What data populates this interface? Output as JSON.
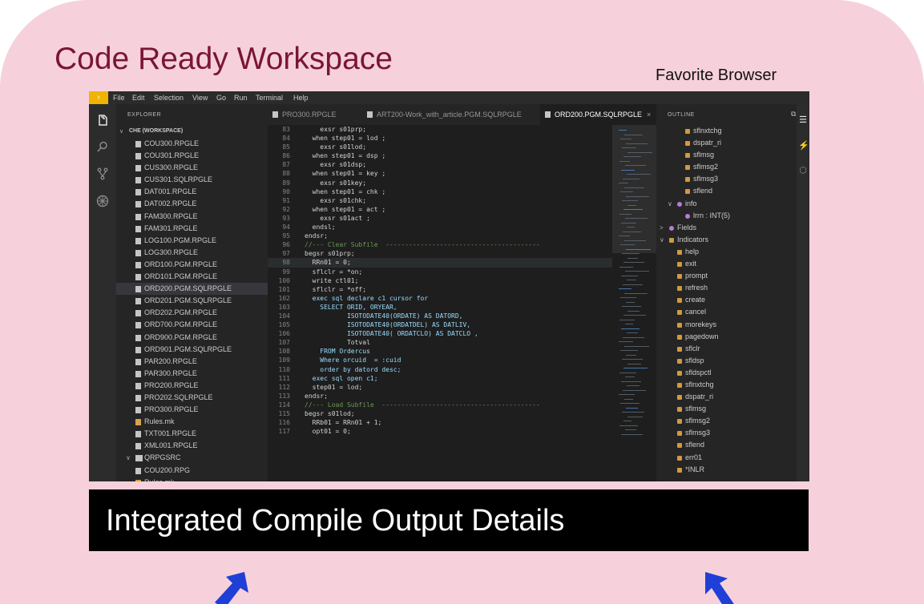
{
  "slide": {
    "title": "Code Ready Workspace",
    "favorite_label": "Favorite Browser",
    "banner_text": "Integrated Compile Output Details",
    "colors": {
      "background": "#f6d1dc",
      "title": "#7a1535",
      "banner": "#000000",
      "arrow": "#1f3fd6"
    }
  },
  "menubar": {
    "items": [
      "File",
      "Edit",
      "Selection",
      "View",
      "Go",
      "Run",
      "Terminal",
      "Help"
    ]
  },
  "activity_icons": [
    "files-icon",
    "search-icon",
    "source-control-icon",
    "extensions-icon"
  ],
  "explorer": {
    "header": "EXPLORER",
    "workspace": "CHE (WORKSPACE)",
    "items": [
      {
        "name": "COU300.RPGLE",
        "type": "file"
      },
      {
        "name": "COU301.RPGLE",
        "type": "file"
      },
      {
        "name": "CUS300.RPGLE",
        "type": "file"
      },
      {
        "name": "CUS301.SQLRPGLE",
        "type": "file"
      },
      {
        "name": "DAT001.RPGLE",
        "type": "file"
      },
      {
        "name": "DAT002.RPGLE",
        "type": "file"
      },
      {
        "name": "FAM300.RPGLE",
        "type": "file"
      },
      {
        "name": "FAM301.RPGLE",
        "type": "file"
      },
      {
        "name": "LOG100.PGM.RPGLE",
        "type": "file"
      },
      {
        "name": "LOG300.RPGLE",
        "type": "file"
      },
      {
        "name": "ORD100.PGM.RPGLE",
        "type": "file"
      },
      {
        "name": "ORD101.PGM.RPGLE",
        "type": "file"
      },
      {
        "name": "ORD200.PGM.SQLRPGLE",
        "type": "file",
        "selected": true
      },
      {
        "name": "ORD201.PGM.SQLRPGLE",
        "type": "file"
      },
      {
        "name": "ORD202.PGM.RPGLE",
        "type": "file"
      },
      {
        "name": "ORD700.PGM.RPGLE",
        "type": "file"
      },
      {
        "name": "ORD900.PGM.RPGLE",
        "type": "file"
      },
      {
        "name": "ORD901.PGM.SQLRPGLE",
        "type": "file"
      },
      {
        "name": "PAR200.RPGLE",
        "type": "file"
      },
      {
        "name": "PAR300.RPGLE",
        "type": "file"
      },
      {
        "name": "PRO200.RPGLE",
        "type": "file"
      },
      {
        "name": "PRO202.SQLRPGLE",
        "type": "file"
      },
      {
        "name": "PRO300.RPGLE",
        "type": "file"
      },
      {
        "name": "Rules.mk",
        "type": "mk"
      },
      {
        "name": "TXT001.RPGLE",
        "type": "file"
      },
      {
        "name": "XML001.RPGLE",
        "type": "file"
      },
      {
        "name": "QRPGSRC",
        "type": "folder"
      },
      {
        "name": "COU200.RPG",
        "type": "file"
      },
      {
        "name": "Rules.mk",
        "type": "mk"
      }
    ]
  },
  "tabs": [
    {
      "label": "PRO300.RPGLE",
      "active": false
    },
    {
      "label": "ART200-Work_with_article.PGM.SQLRPGLE",
      "active": false
    },
    {
      "label": "ORD200.PGM.SQLRPGLE",
      "active": true,
      "close": "×"
    }
  ],
  "editor": {
    "lines": [
      {
        "n": "83",
        "t": "    exsr s01prp;"
      },
      {
        "n": "84",
        "t": "  when step01 = lod ;"
      },
      {
        "n": "85",
        "t": "    exsr s01lod;"
      },
      {
        "n": "86",
        "t": "  when step01 = dsp ;"
      },
      {
        "n": "87",
        "t": "    exsr s01dsp;"
      },
      {
        "n": "88",
        "t": "  when step01 = key ;"
      },
      {
        "n": "89",
        "t": "    exsr s01key;"
      },
      {
        "n": "90",
        "t": "  when step01 = chk ;"
      },
      {
        "n": "91",
        "t": "    exsr s01chk;"
      },
      {
        "n": "92",
        "t": "  when step01 = act ;"
      },
      {
        "n": "93",
        "t": "    exsr s01act ;"
      },
      {
        "n": "94",
        "t": "  endsl;"
      },
      {
        "n": "95",
        "t": "endsr;"
      },
      {
        "n": "96",
        "t": "//--- Clear Subfile  ----------------------------------------"
      },
      {
        "n": "97",
        "t": "begsr s01prp;"
      },
      {
        "n": "98",
        "t": "  RRn01 = 0;",
        "current": true
      },
      {
        "n": "99",
        "t": "  sflclr = *on;"
      },
      {
        "n": "100",
        "t": "  write ctl01;"
      },
      {
        "n": "101",
        "t": "  sflclr = *off;"
      },
      {
        "n": "102",
        "t": "  exec sql declare c1 cursor for"
      },
      {
        "n": "103",
        "t": "    SELECT ORID, ORYEAR,"
      },
      {
        "n": "104",
        "t": "           ISOTODATE40(ORDATE) AS DATORD,"
      },
      {
        "n": "105",
        "t": "           ISOTODATE40(ORDATDEL) AS DATLIV,"
      },
      {
        "n": "106",
        "t": "           ISOTODATE40( ORDATCLO) AS DATCLO ,"
      },
      {
        "n": "107",
        "t": "           Totval"
      },
      {
        "n": "108",
        "t": "    FROM Ordercus"
      },
      {
        "n": "109",
        "t": "    Where orcuid  = :cuid"
      },
      {
        "n": "110",
        "t": "    order by datord desc;"
      },
      {
        "n": "111",
        "t": "  exec sql open c1;"
      },
      {
        "n": "112",
        "t": "  step01 = lod;"
      },
      {
        "n": "113",
        "t": "endsr;"
      },
      {
        "n": "114",
        "t": "//--- Load Subfile  -----------------------------------------"
      },
      {
        "n": "115",
        "t": "begsr s01lod;"
      },
      {
        "n": "116",
        "t": "  RRb01 = RRn01 + 1;"
      },
      {
        "n": "117",
        "t": "  opt01 = 0;"
      }
    ]
  },
  "outline": {
    "header": "OUTLINE",
    "items": [
      {
        "label": "sflnxtchg",
        "indent": 2,
        "kind": "field"
      },
      {
        "label": "dspatr_ri",
        "indent": 2,
        "kind": "field"
      },
      {
        "label": "sflmsg",
        "indent": 2,
        "kind": "field"
      },
      {
        "label": "sflmsg2",
        "indent": 2,
        "kind": "field"
      },
      {
        "label": "sflmsg3",
        "indent": 2,
        "kind": "field"
      },
      {
        "label": "sflend",
        "indent": 2,
        "kind": "field"
      },
      {
        "label": "info",
        "indent": 1,
        "kind": "struct",
        "chevron": "∨"
      },
      {
        "label": "lrrn : INT(5)",
        "indent": 2,
        "kind": "struct"
      },
      {
        "label": "Fields",
        "indent": 0,
        "kind": "struct",
        "chevron": ">"
      },
      {
        "label": "Indicators",
        "indent": 0,
        "kind": "field",
        "chevron": "∨"
      },
      {
        "label": "help",
        "indent": 1,
        "kind": "field"
      },
      {
        "label": "exit",
        "indent": 1,
        "kind": "field"
      },
      {
        "label": "prompt",
        "indent": 1,
        "kind": "field"
      },
      {
        "label": "refresh",
        "indent": 1,
        "kind": "field"
      },
      {
        "label": "create",
        "indent": 1,
        "kind": "field"
      },
      {
        "label": "cancel",
        "indent": 1,
        "kind": "field"
      },
      {
        "label": "morekeys",
        "indent": 1,
        "kind": "field"
      },
      {
        "label": "pagedown",
        "indent": 1,
        "kind": "field"
      },
      {
        "label": "sflclr",
        "indent": 1,
        "kind": "field"
      },
      {
        "label": "sfldsp",
        "indent": 1,
        "kind": "field"
      },
      {
        "label": "sfldspctl",
        "indent": 1,
        "kind": "field"
      },
      {
        "label": "sflnxtchg",
        "indent": 1,
        "kind": "field"
      },
      {
        "label": "dspatr_ri",
        "indent": 1,
        "kind": "field"
      },
      {
        "label": "sflmsg",
        "indent": 1,
        "kind": "field"
      },
      {
        "label": "sflmsg2",
        "indent": 1,
        "kind": "field"
      },
      {
        "label": "sflmsg3",
        "indent": 1,
        "kind": "field"
      },
      {
        "label": "sflend",
        "indent": 1,
        "kind": "field"
      },
      {
        "label": "err01",
        "indent": 1,
        "kind": "field"
      },
      {
        "label": "*INLR",
        "indent": 1,
        "kind": "field"
      }
    ]
  },
  "right_icons": [
    "outline-list-icon",
    "plug-icon",
    "cube-icon"
  ]
}
